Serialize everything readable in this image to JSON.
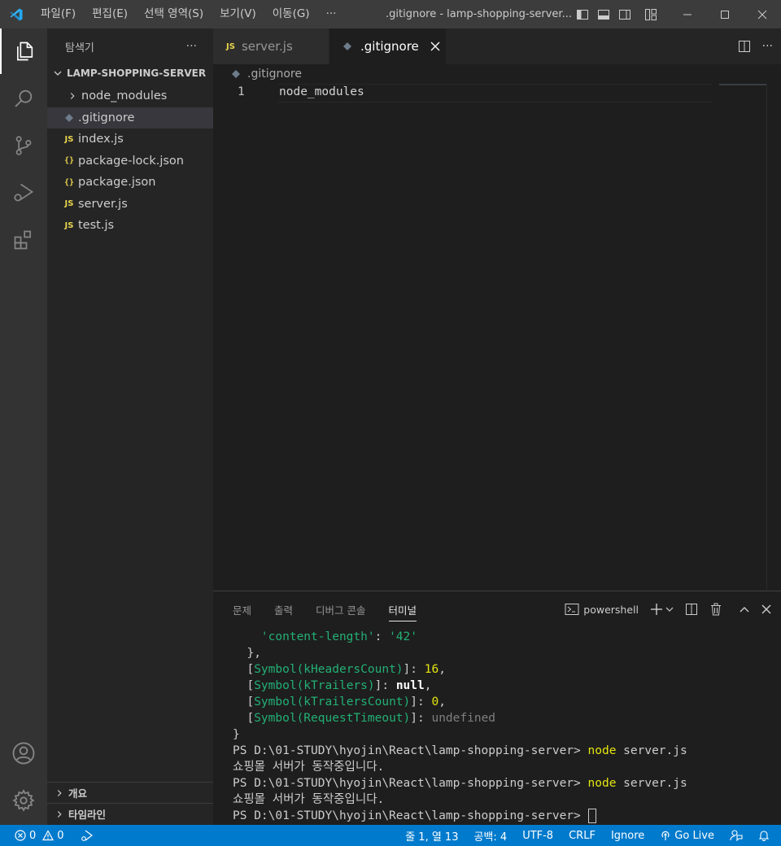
{
  "titlebar": {
    "menu": [
      "파일(F)",
      "편집(E)",
      "선택 영역(S)",
      "보기(V)",
      "이동(G)",
      "···"
    ],
    "title": ".gitignore - lamp-shopping-server..."
  },
  "sidebar": {
    "header": "탐색기",
    "more": "···",
    "folder": "LAMP-SHOPPING-SERVER",
    "items": [
      {
        "label": "node_modules",
        "icon": "chevron-right-icon",
        "selected": false
      },
      {
        "label": ".gitignore",
        "icon": "diamond-icon",
        "selected": true
      },
      {
        "label": "index.js",
        "icon": "js-icon",
        "icon_text": "JS"
      },
      {
        "label": "package-lock.json",
        "icon": "json-icon",
        "icon_text": "{}"
      },
      {
        "label": "package.json",
        "icon": "json-icon",
        "icon_text": "{}"
      },
      {
        "label": "server.js",
        "icon": "js-icon",
        "icon_text": "JS"
      },
      {
        "label": "test.js",
        "icon": "js-icon",
        "icon_text": "JS"
      }
    ],
    "outline": "개요",
    "timeline": "타임라인"
  },
  "tabs": [
    {
      "label": "server.js",
      "icon_text": "JS",
      "active": false
    },
    {
      "label": ".gitignore",
      "active": true
    }
  ],
  "editor": {
    "breadcrumb": ".gitignore",
    "lines": [
      {
        "num": "1",
        "text": "node_modules"
      }
    ]
  },
  "panel": {
    "tabs": [
      "문제",
      "출력",
      "디버그 콘솔",
      "터미널"
    ],
    "active_tab": "터미널",
    "shell": "powershell",
    "terminal": {
      "l1_key": "'content-length'",
      "l1_sep": ": ",
      "l1_val": "'42'",
      "l2": "  },",
      "l3_sym": "Symbol(kHeadersCount)",
      "l3_val": "16",
      "l4_sym": "Symbol(kTrailers)",
      "l4_val": "null",
      "l5_sym": "Symbol(kTrailersCount)",
      "l5_val": "0",
      "l6_sym": "Symbol(RequestTimeout)",
      "l6_val": "undefined",
      "l7": "}",
      "prompt": "PS D:\\01-STUDY\\hyojin\\React\\lamp-shopping-server> ",
      "cmd_node": "node",
      "cmd_arg": " server.js",
      "output": "쇼핑몰 서버가 동작중입니다."
    }
  },
  "status": {
    "errors": "0",
    "warnings": "0",
    "position": "줄 1, 열 13",
    "spaces": "공백: 4",
    "encoding": "UTF-8",
    "eol": "CRLF",
    "language": "Ignore",
    "golive": "Go Live"
  },
  "colors": {
    "statusbar": "#007acc",
    "activitybar": "#333333",
    "sidebar": "#252526",
    "editor": "#1e1e1e"
  }
}
